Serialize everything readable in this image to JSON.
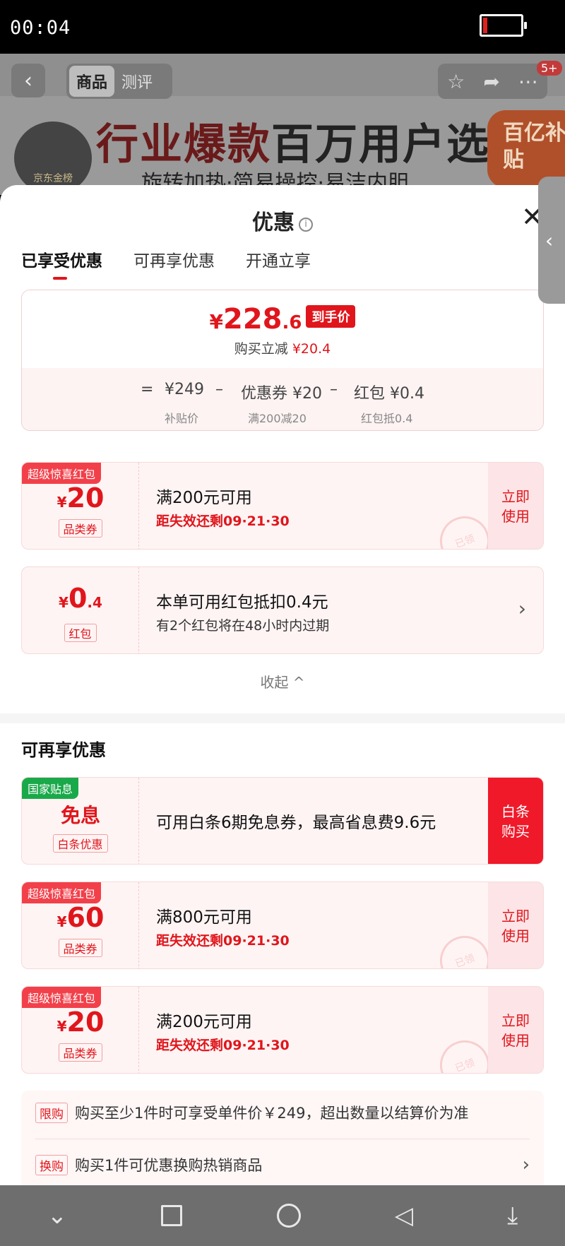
{
  "status_bar": {
    "time": "00:04"
  },
  "product_header": {
    "tabs": [
      "商品",
      "测评"
    ],
    "badge": "5+",
    "logo_text": "京东金榜",
    "slogan_red": "行业爆款",
    "slogan_dark": "百万用户选",
    "sub_slogan": "旋转加热·简易操控·易洁内胆",
    "subsidy_badge": "百亿补贴"
  },
  "sheet": {
    "title": "优惠",
    "tabs": [
      "已享受优惠",
      "可再享优惠",
      "开通立享"
    ],
    "summary": {
      "price_yen": "¥",
      "price_int": "228",
      "price_dec": ".6",
      "price_tag": "到手价",
      "reduce_label": "购买立减",
      "reduce_value": "¥20.4",
      "formula": {
        "eq": "=",
        "item1": "¥249",
        "item1_sub": "补贴价",
        "minus": "–",
        "item2": "优惠券 ¥20",
        "item2_sub": "满200减20",
        "item3": "红包 ¥0.4",
        "item3_sub": "红包抵0.4"
      }
    },
    "enjoyed": [
      {
        "ribbon": "超级惊喜红包",
        "yen": "¥",
        "amount": "20",
        "kind": "品类券",
        "condition": "满200元可用",
        "expiry": "距失效还剩09·21·30",
        "action": "立即使用",
        "stamp": "已领"
      },
      {
        "yen": "¥",
        "amount": "0",
        "amount_dec": ".4",
        "kind": "红包",
        "condition": "本单可用红包抵扣0.4元",
        "note": "有2个红包将在48小时内过期"
      }
    ],
    "collapse_label": "收起 ^",
    "more_section_title": "可再享优惠",
    "more": [
      {
        "ribbon": "国家贴息",
        "title": "免息",
        "kind": "白条优惠",
        "condition": "可用白条6期免息券，最高省息费9.6元",
        "action": "白条购买"
      },
      {
        "ribbon": "超级惊喜红包",
        "yen": "¥",
        "amount": "60",
        "kind": "品类券",
        "condition": "满800元可用",
        "expiry": "距失效还剩09·21·30",
        "action": "立即使用",
        "stamp": "已领"
      },
      {
        "ribbon": "超级惊喜红包",
        "yen": "¥",
        "amount": "20",
        "kind": "品类券",
        "condition": "满200元可用",
        "expiry": "距失效还剩09·21·30",
        "action": "立即使用",
        "stamp": "已领"
      }
    ],
    "info_rows": [
      {
        "tag": "限购",
        "text": "购买至少1件时可享受单件价￥249，超出数量以结算价为准"
      },
      {
        "tag": "换购",
        "text": "购买1件可优惠换购热销商品"
      }
    ]
  },
  "colors": {
    "accent": "#e0161c",
    "green": "#1aa94a",
    "nav_bg": "#6e6e6e"
  }
}
